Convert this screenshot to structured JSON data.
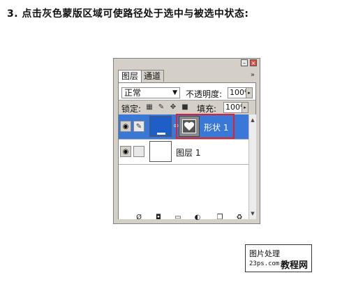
{
  "instruction": "3. 点击灰色蒙版区域可使路径处于选中与被选中状态:",
  "panel": {
    "tabs": [
      "图层",
      "通道"
    ],
    "tab_menu": "»",
    "blend_mode": "正常",
    "opacity_label": "不透明度:",
    "opacity_value": "100%",
    "lock_label": "锁定:",
    "fill_label": "填充:",
    "fill_value": "100%",
    "layers": [
      {
        "name": "形状 1",
        "selected": true,
        "thumb_color": "#1e5ec8"
      },
      {
        "name": "图层 1",
        "selected": false,
        "thumb_color": "#ffffff"
      }
    ],
    "highlight_color": "#e21f2b",
    "selected_color": "#3a78d8"
  },
  "watermark": {
    "line1": "图片处理",
    "line2": "23ps.com",
    "line3": "教程网"
  }
}
